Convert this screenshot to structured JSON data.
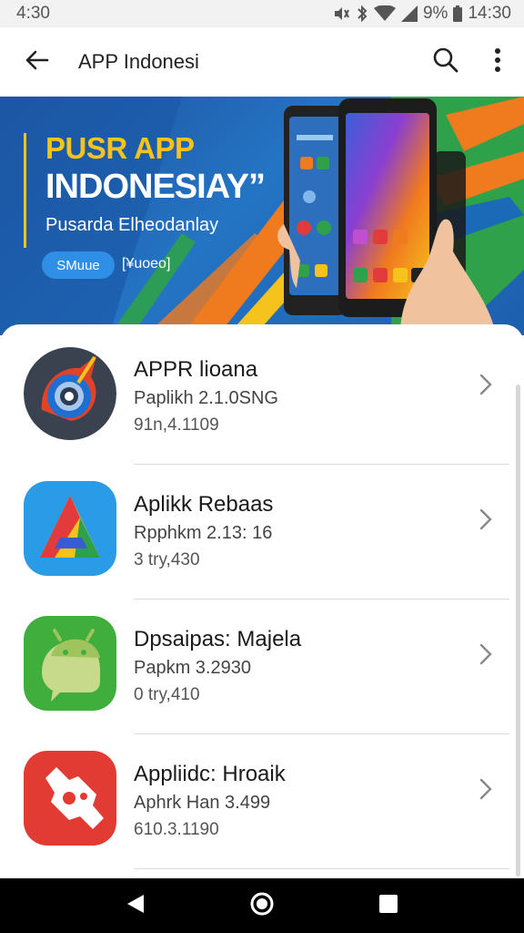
{
  "status_bar": {
    "left_time": "4:30",
    "battery": "9%",
    "right_time": "14:30",
    "icons": [
      "mute-icon",
      "bluetooth-icon",
      "wifi-icon",
      "signal-icon",
      "battery-icon"
    ]
  },
  "app_bar": {
    "title": "APP Indonesi",
    "icons": [
      "back-arrow-icon",
      "search-icon",
      "more-vert-icon"
    ]
  },
  "banner": {
    "line1": "PUSR APP",
    "line2": "INDONESIAY”",
    "subtitle": "Pusarda Elheodanlay",
    "pill_label": "SMuue",
    "pill_side_text": "[¥uoeo]",
    "colors": {
      "yellow": "#f6c21c",
      "blue": "#1d5fae",
      "orange": "#f07a1e",
      "green": "#2fa14a"
    }
  },
  "list": {
    "items": [
      {
        "title": "APPR lioana",
        "subtitle": "Paplikh 2.1.0SNG",
        "meta": "91n,4.1109",
        "icon": "target-compass-icon"
      },
      {
        "title": "Aplikk Rebaas",
        "subtitle": "Rpphkm 2.13: 16",
        "meta": "3 try,430",
        "icon": "triangle-logo-icon"
      },
      {
        "title": "Dpsaipas: Majela",
        "subtitle": "Papkm 3.2930",
        "meta": "0 try,410",
        "icon": "android-icon"
      },
      {
        "title": "Appliidc: Hroaik",
        "subtitle": "Aphrk Han 3.499",
        "meta": "610.3.1190",
        "icon": "wrench-tool-icon"
      }
    ]
  },
  "nav_bar": {
    "icons": [
      "back-triangle-icon",
      "home-circle-icon",
      "recents-square-icon"
    ]
  }
}
